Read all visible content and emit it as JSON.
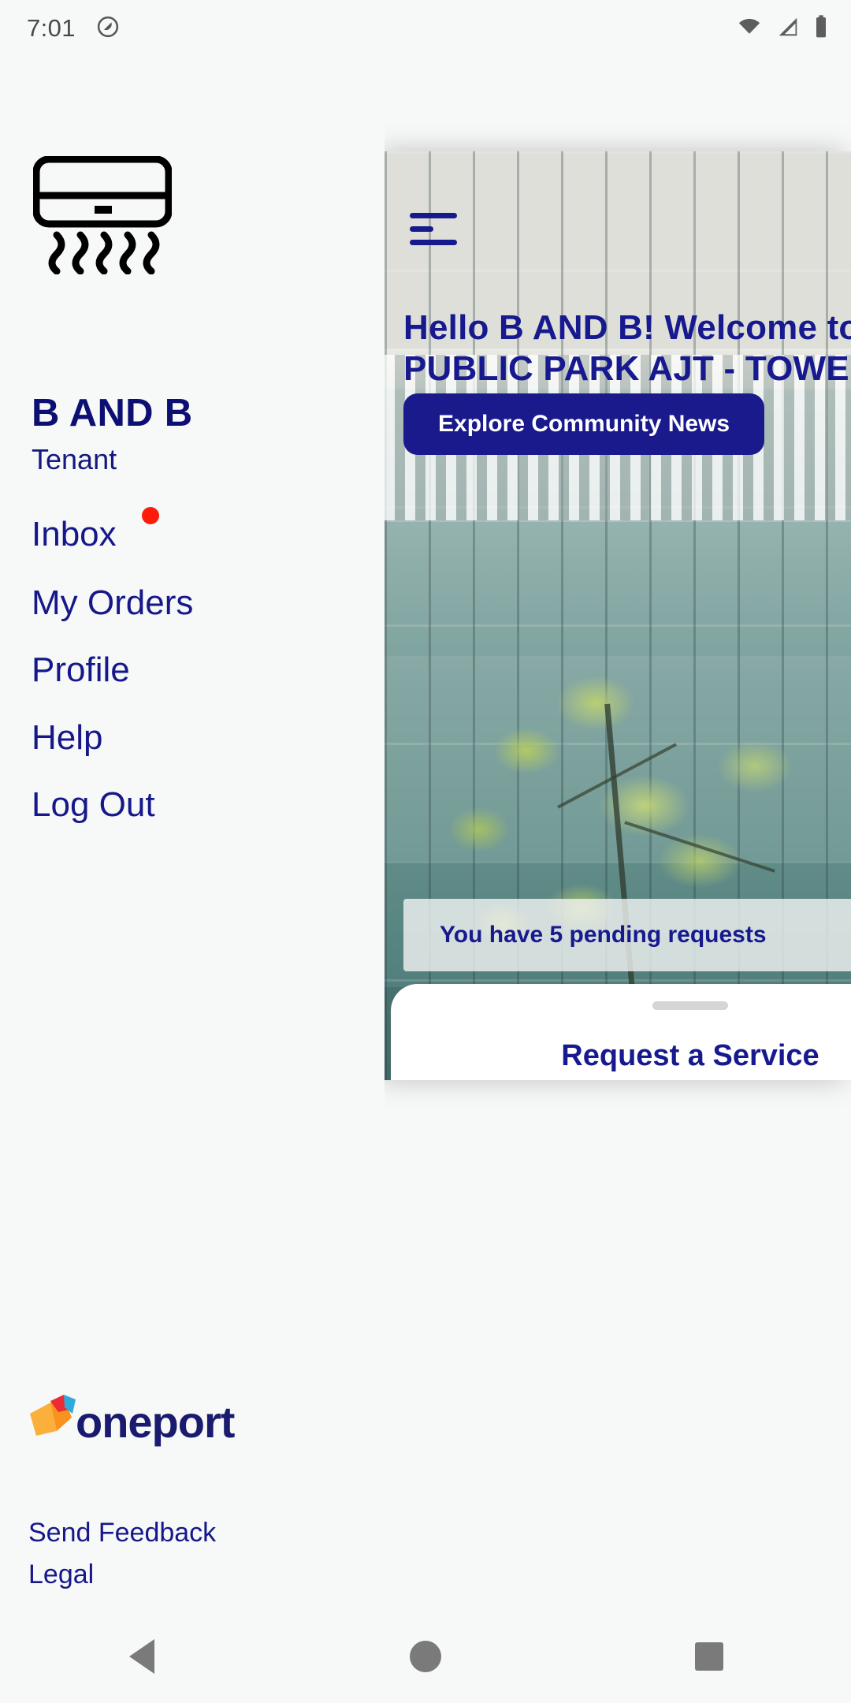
{
  "status_bar": {
    "time": "7:01",
    "icons": [
      "sync-icon",
      "wifi-icon",
      "cellular-signal-icon",
      "battery-icon"
    ]
  },
  "drawer": {
    "profile_icon": "air-conditioner-icon",
    "user_name": "B AND B",
    "user_role": "Tenant",
    "menu_items": [
      {
        "label": "Inbox",
        "badge": true,
        "badge_color": "#ff1b0b"
      },
      {
        "label": "My Orders",
        "badge": false
      },
      {
        "label": "Profile",
        "badge": false
      },
      {
        "label": "Help",
        "badge": false
      },
      {
        "label": "Log Out",
        "badge": false
      }
    ],
    "brand_logo": "oneport",
    "footer_links": [
      "Send Feedback",
      "Legal"
    ]
  },
  "app_screen": {
    "menu_icon": "hamburger-menu-icon",
    "heading": "Hello B AND B! Welcome to QATAR PUBLIC PARK AJT - TOWER.",
    "explore_button": "Explore Community News",
    "pending_banner": "You have 5 pending requests",
    "bottom_sheet_title": "Request a Service"
  },
  "nav_bar": {
    "back": "back-icon",
    "home": "home-icon",
    "recents": "recents-icon"
  },
  "colors": {
    "navy": "#16188a",
    "deep_navy": "#0d1073",
    "accent_red": "#ff1b0b",
    "background": "#f7f8f8"
  }
}
